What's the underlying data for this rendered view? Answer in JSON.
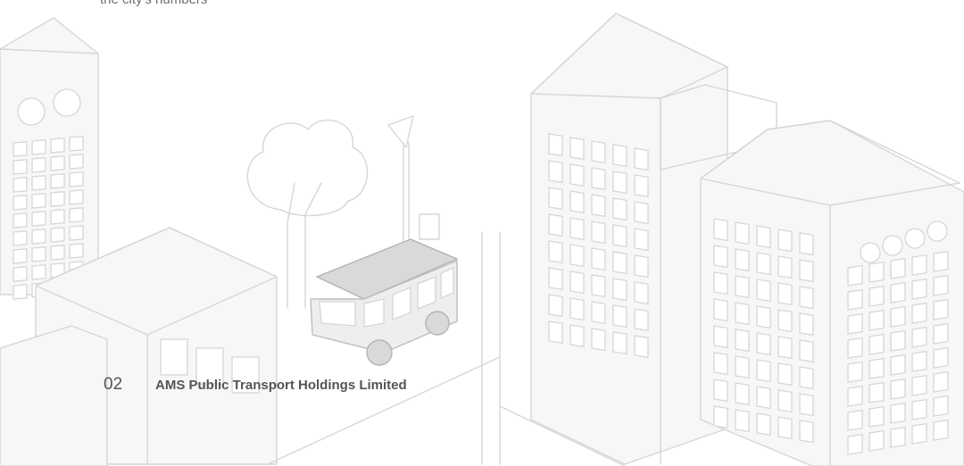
{
  "document": {
    "top_text": "the city's numbers",
    "page_number": "02",
    "company_name": "AMS Public Transport Holdings Limited"
  }
}
